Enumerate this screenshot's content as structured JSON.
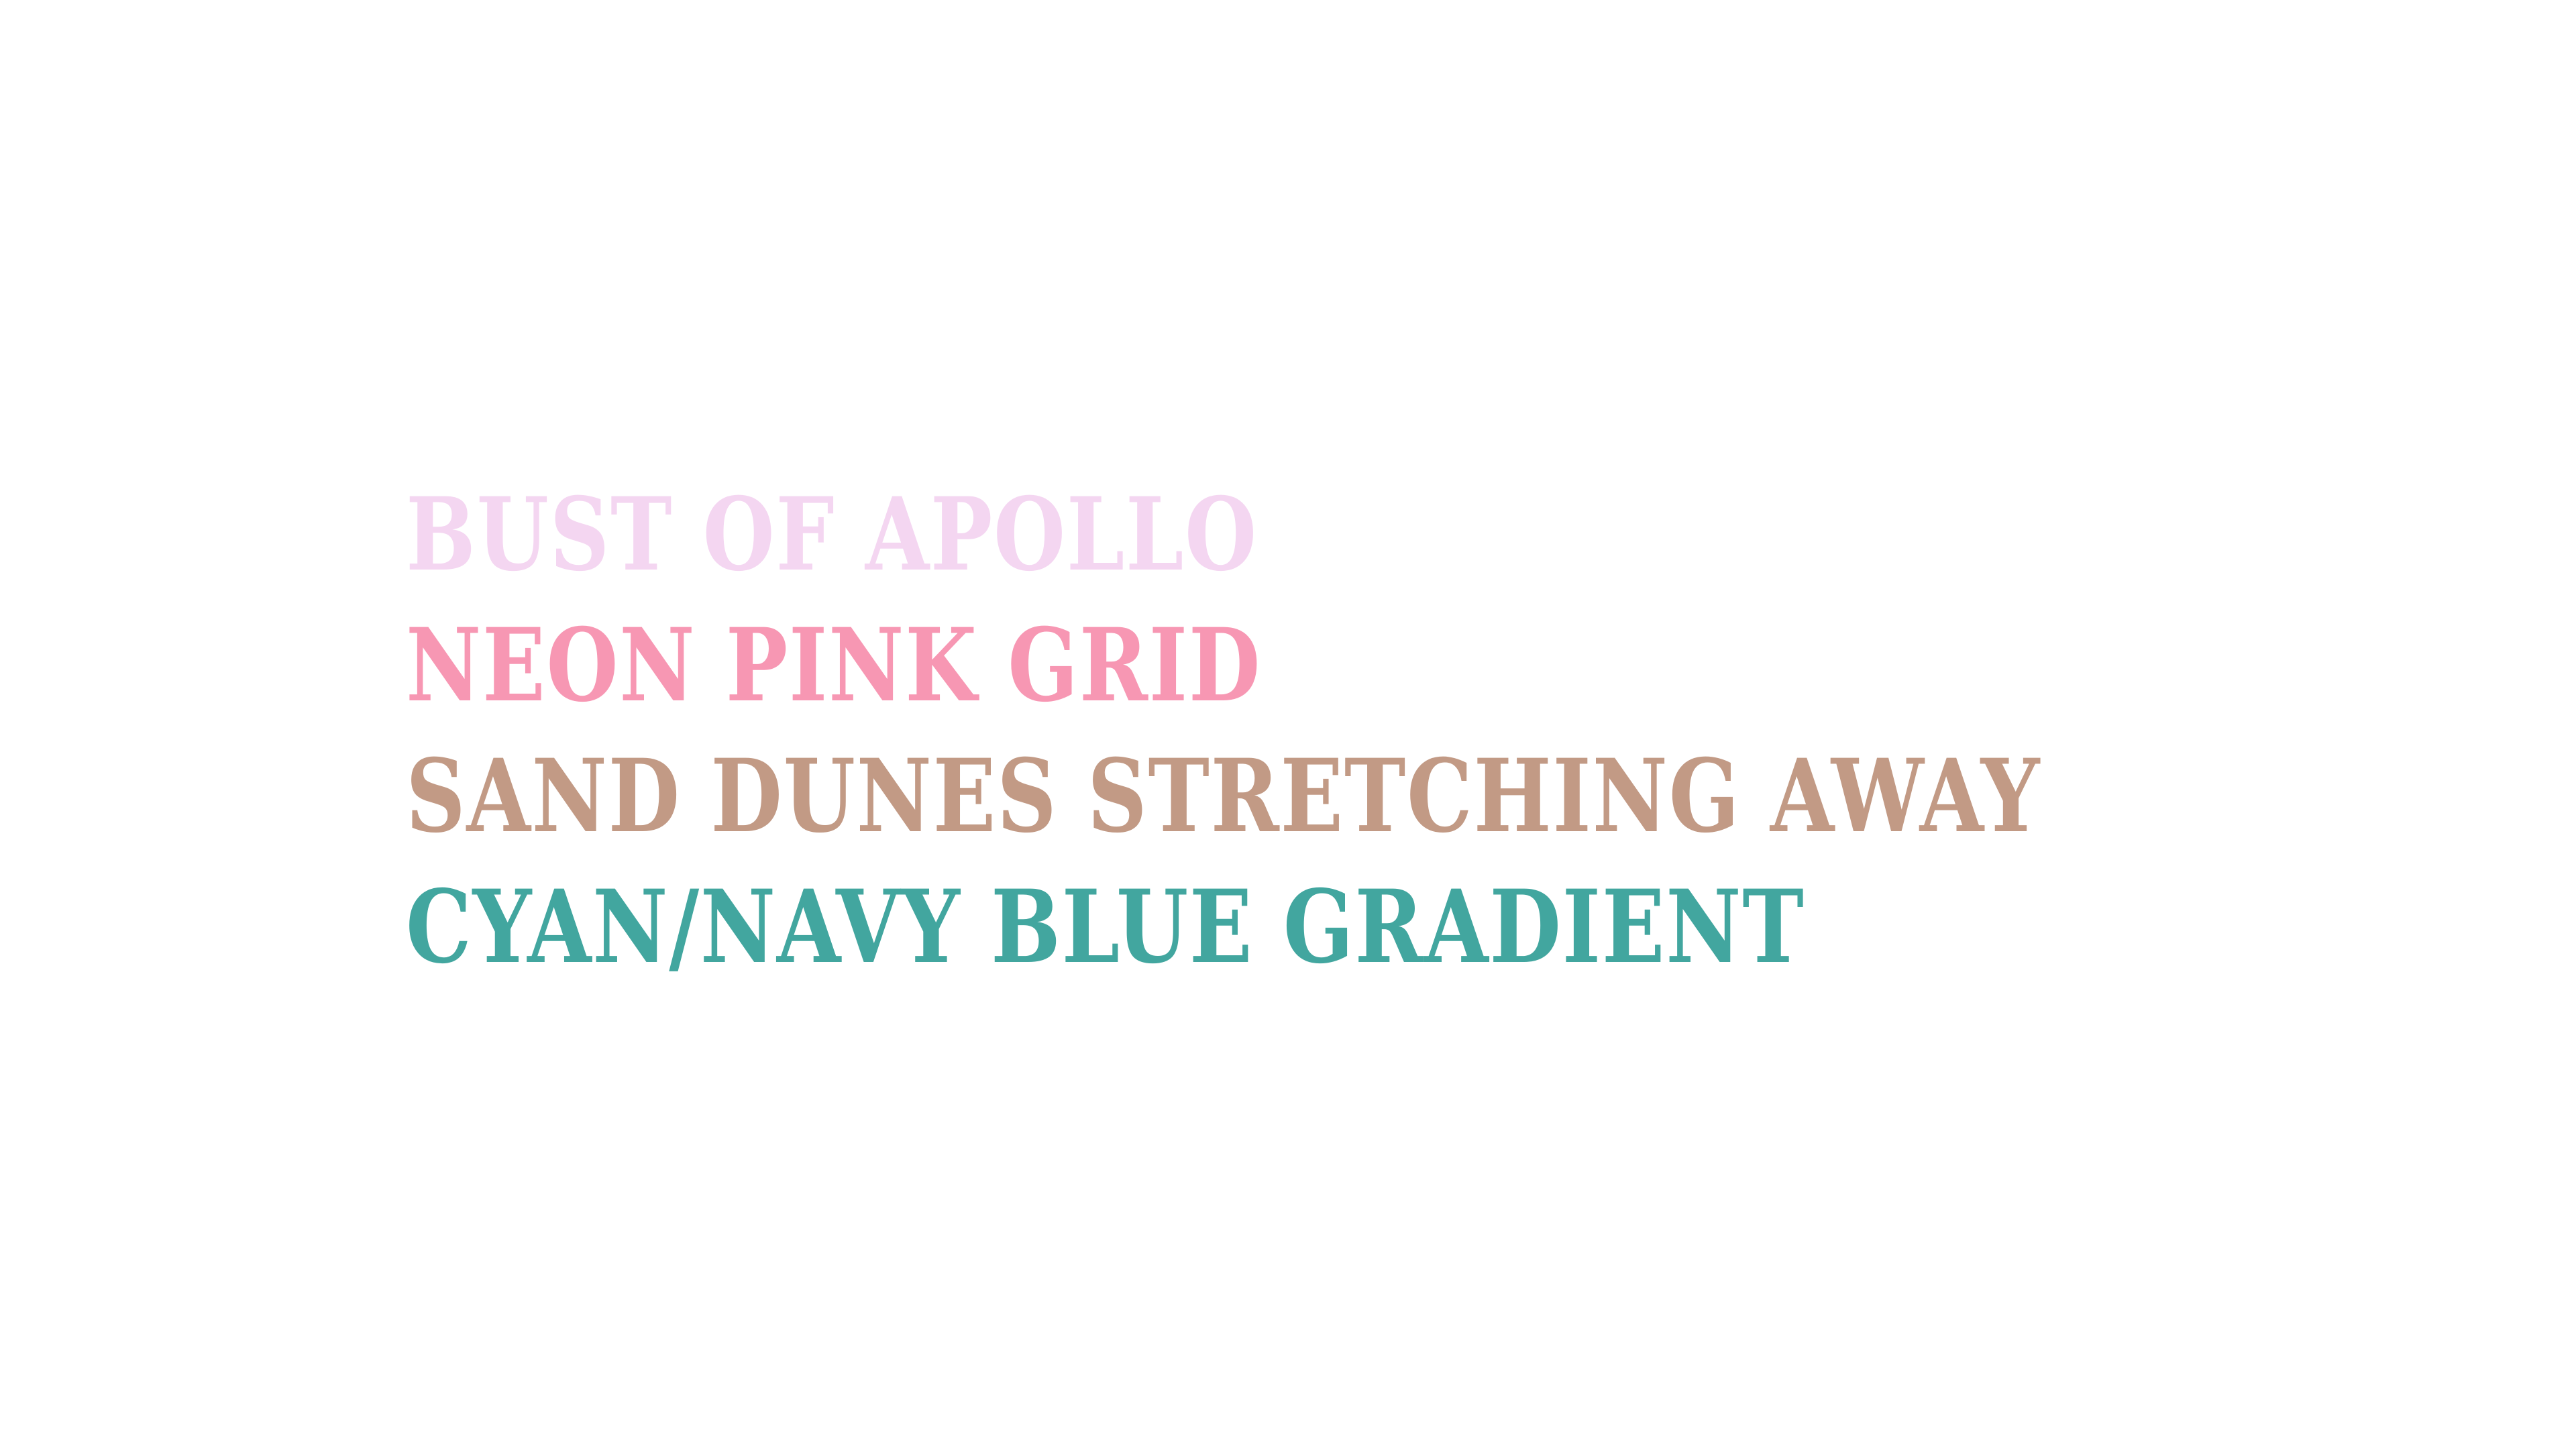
{
  "lines": [
    {
      "text": "BUST OF APOLLO",
      "color": "#f4d6f1"
    },
    {
      "text": "NEON PINK GRID",
      "color": "#f797b3"
    },
    {
      "text": "SAND DUNES STRETCHING AWAY",
      "color": "#c29a85"
    },
    {
      "text": "CYAN/NAVY BLUE GRADIENT",
      "color": "#42a69f"
    }
  ]
}
